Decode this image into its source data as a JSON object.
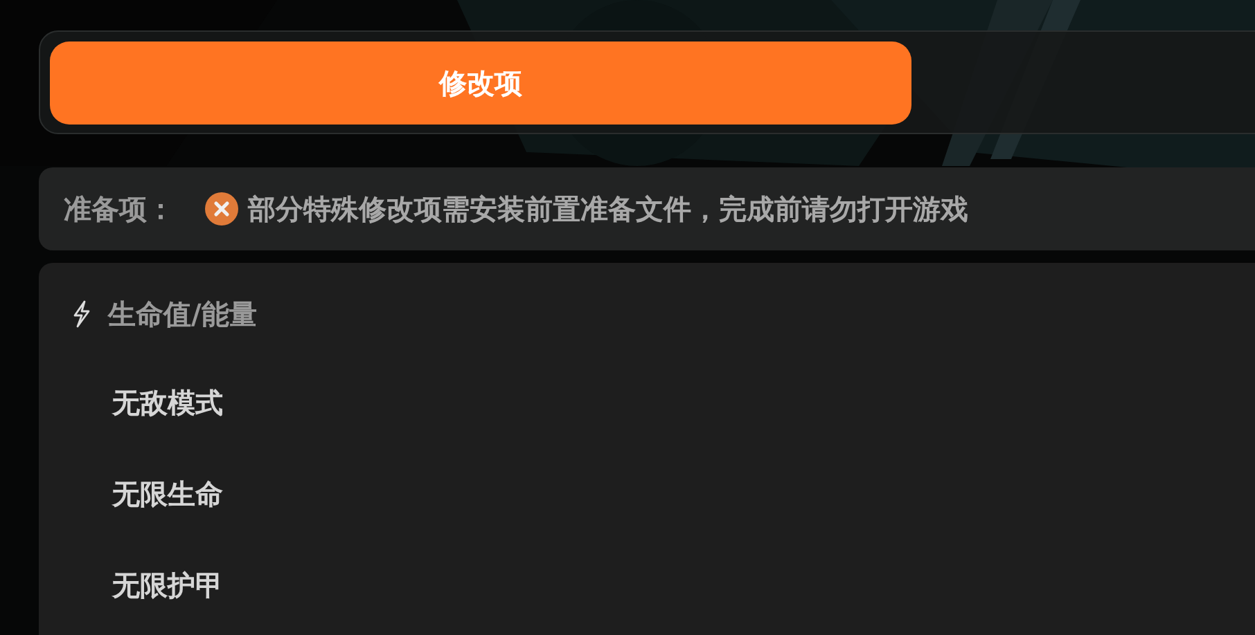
{
  "tabs": [
    {
      "label": "修改项",
      "selected": true
    }
  ],
  "prerequisite": {
    "label": "准备项：",
    "ready": false,
    "message": "部分特殊修改项需安装前置准备文件，完成前请勿打开游戏"
  },
  "section": {
    "title": "生命值/能量",
    "items": [
      {
        "label": "无敌模式"
      },
      {
        "label": "无限生命"
      },
      {
        "label": "无限护甲"
      }
    ]
  }
}
